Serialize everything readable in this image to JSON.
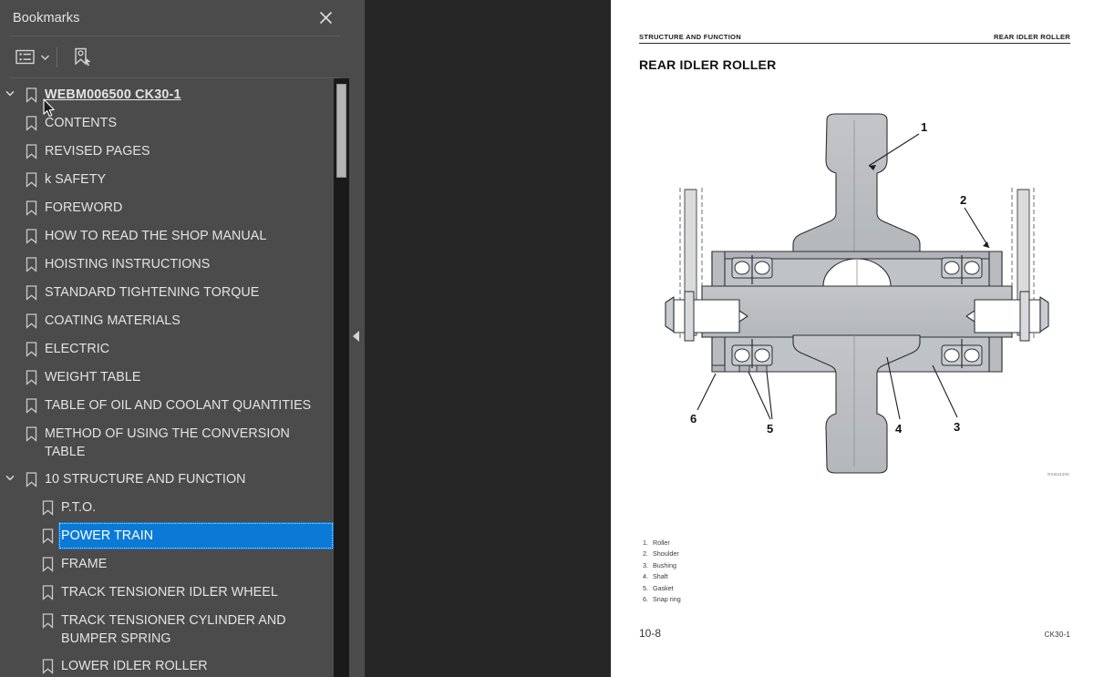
{
  "sidebar": {
    "title": "Bookmarks",
    "close_icon": "close-icon",
    "toolbar": {
      "list_options_icon": "list-options-icon",
      "caret_icon": "chevron-down-icon",
      "new_bookmark_icon": "new-bookmark-icon"
    },
    "tree": [
      {
        "label": "WEBM006500 CK30-1",
        "depth": 0,
        "expander": "chevron-down",
        "root": true,
        "selected": false
      },
      {
        "label": "CONTENTS",
        "depth": 1,
        "expander": "none",
        "root": false,
        "selected": false
      },
      {
        "label": "REVISED PAGES",
        "depth": 1,
        "expander": "none",
        "root": false,
        "selected": false
      },
      {
        "label": "k SAFETY",
        "depth": 1,
        "expander": "none",
        "root": false,
        "selected": false
      },
      {
        "label": "FOREWORD",
        "depth": 1,
        "expander": "none",
        "root": false,
        "selected": false
      },
      {
        "label": "HOW TO READ THE SHOP MANUAL",
        "depth": 1,
        "expander": "none",
        "root": false,
        "selected": false
      },
      {
        "label": "HOISTING INSTRUCTIONS",
        "depth": 1,
        "expander": "none",
        "root": false,
        "selected": false
      },
      {
        "label": "STANDARD TIGHTENING TORQUE",
        "depth": 1,
        "expander": "none",
        "root": false,
        "selected": false
      },
      {
        "label": "COATING MATERIALS",
        "depth": 1,
        "expander": "none",
        "root": false,
        "selected": false
      },
      {
        "label": "ELECTRIC",
        "depth": 1,
        "expander": "none",
        "root": false,
        "selected": false
      },
      {
        "label": "WEIGHT TABLE",
        "depth": 1,
        "expander": "none",
        "root": false,
        "selected": false
      },
      {
        "label": "TABLE OF OIL AND COOLANT QUANTITIES",
        "depth": 1,
        "expander": "none",
        "root": false,
        "selected": false
      },
      {
        "label": "METHOD OF USING THE CONVERSION TABLE",
        "depth": 1,
        "expander": "none",
        "root": false,
        "selected": false
      },
      {
        "label": "10 STRUCTURE AND FUNCTION",
        "depth": 1,
        "expander": "chevron-down",
        "root": false,
        "selected": false
      },
      {
        "label": "P.T.O.",
        "depth": 2,
        "expander": "none",
        "root": false,
        "selected": false
      },
      {
        "label": "POWER TRAIN",
        "depth": 2,
        "expander": "none",
        "root": false,
        "selected": true
      },
      {
        "label": "FRAME",
        "depth": 2,
        "expander": "none",
        "root": false,
        "selected": false
      },
      {
        "label": "TRACK TENSIONER IDLER WHEEL",
        "depth": 2,
        "expander": "none",
        "root": false,
        "selected": false
      },
      {
        "label": "TRACK TENSIONER CYLINDER AND BUMPER SPRING",
        "depth": 2,
        "expander": "none",
        "root": false,
        "selected": false
      },
      {
        "label": "LOWER IDLER ROLLER",
        "depth": 2,
        "expander": "none",
        "root": false,
        "selected": false
      }
    ],
    "scrollbar": "vertical-scrollbar",
    "collapse_arrow_icon": "collapse-panel-arrow-icon"
  },
  "document": {
    "header_left": "STRUCTURE AND FUNCTION",
    "header_right": "REAR IDLER ROLLER",
    "title": "REAR IDLER ROLLER",
    "figure_code": "RKB34200",
    "callouts": [
      "1",
      "2",
      "3",
      "4",
      "5",
      "6"
    ],
    "parts": [
      {
        "num": "1.",
        "name": "Roller"
      },
      {
        "num": "2.",
        "name": "Shoulder"
      },
      {
        "num": "3.",
        "name": "Bushing"
      },
      {
        "num": "4.",
        "name": "Shaft"
      },
      {
        "num": "5.",
        "name": "Gasket"
      },
      {
        "num": "6.",
        "name": "Snap ring"
      }
    ],
    "footer_left": "10-8",
    "footer_right": "CK30-1"
  },
  "colors": {
    "sidebar_bg": "#4b4b4b",
    "viewer_bg": "#262626",
    "selection_blue": "#0a7ad6",
    "page_bg": "#ffffff"
  }
}
